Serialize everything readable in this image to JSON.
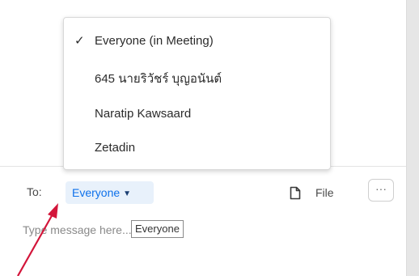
{
  "recipient_menu": {
    "items": [
      {
        "label": "Everyone (in Meeting)",
        "selected": true
      },
      {
        "label": "645 นายริวัชร์ บุญอนันต์",
        "selected": false
      },
      {
        "label": "Naratip Kawsaard",
        "selected": false
      },
      {
        "label": "Zetadin",
        "selected": false
      }
    ],
    "check_glyph": "✓"
  },
  "composer": {
    "to_label": "To:",
    "to_value": "Everyone",
    "file_label": "File",
    "more_label": "···",
    "message_placeholder": "Type message here...",
    "tooltip": "Everyone"
  },
  "colors": {
    "accent": "#0e71eb",
    "arrow": "#d3153a"
  }
}
